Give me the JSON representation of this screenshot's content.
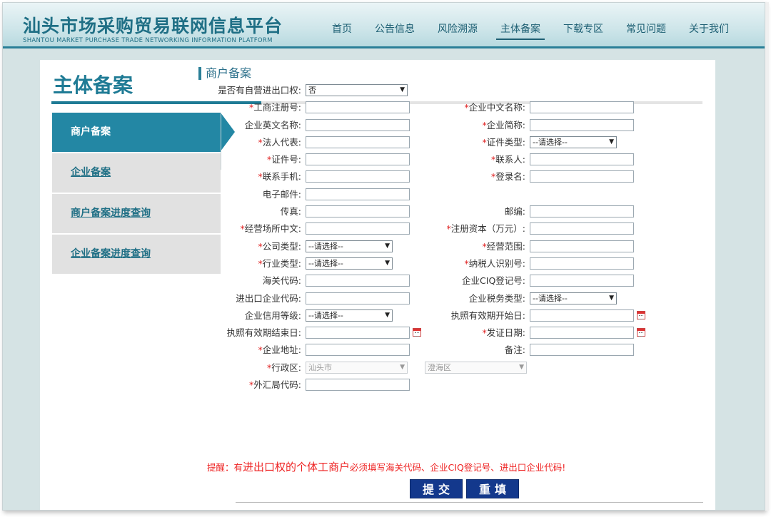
{
  "header": {
    "title_cn": "汕头市场采购贸易联网信息平台",
    "title_en": "SHANTOU MARKET PURCHASE TRADE NETWORKING INFORMATION PLATFORM",
    "nav": [
      {
        "label": "首页"
      },
      {
        "label": "公告信息"
      },
      {
        "label": "风险溯源"
      },
      {
        "label": "主体备案",
        "active": true
      },
      {
        "label": "下载专区"
      },
      {
        "label": "常见问题"
      },
      {
        "label": "关于我们"
      }
    ]
  },
  "page": {
    "title": "主体备案"
  },
  "sidebar": {
    "items": [
      {
        "label": "商户备案",
        "active": true
      },
      {
        "label": "企业备案"
      },
      {
        "label": "商户备案进度查询"
      },
      {
        "label": "企业备案进度查询"
      }
    ]
  },
  "form": {
    "heading": "商户备案",
    "self_export": {
      "label": "是否有自营进出口权:",
      "value": "否"
    },
    "select_placeholder": "--请选择--",
    "fields": {
      "biz_reg_no": "工商注册号:",
      "company_cn_name": "企业中文名称:",
      "company_en_name": "企业英文名称:",
      "company_short": "企业简称:",
      "legal_rep": "法人代表:",
      "id_type": "证件类型:",
      "id_no": "证件号:",
      "contact": "联系人:",
      "contact_phone": "联系手机:",
      "login_name": "登录名:",
      "email": "电子邮件:",
      "fax": "传真:",
      "postcode": "邮编:",
      "biz_place_cn": "经营场所中文:",
      "reg_capital": "注册资本（万元）:",
      "company_type": "公司类型:",
      "biz_scope": "经营范围:",
      "industry_type": "行业类型:",
      "taxpayer_id": "纳税人识别号:",
      "customs_code": "海关代码:",
      "ciq_code": "企业CIQ登记号:",
      "ie_company_code": "进出口企业代码:",
      "tax_type": "企业税务类型:",
      "credit_level": "企业信用等级:",
      "license_start": "执照有效期开始日:",
      "license_end": "执照有效期结束日:",
      "issue_date": "发证日期:",
      "address": "企业地址:",
      "remark": "备注:",
      "district": "行政区:",
      "forex_code": "外汇局代码:"
    },
    "district_city": "汕头市",
    "district_area": "澄海区",
    "tip_prefix": "提醒：有",
    "tip_highlight": "进出口权的个体工商户",
    "tip_suffix": "必须填写海关代码、企业CIQ登记号、进出口企业代码!",
    "submit_label": "提交",
    "reset_label": "重填"
  }
}
